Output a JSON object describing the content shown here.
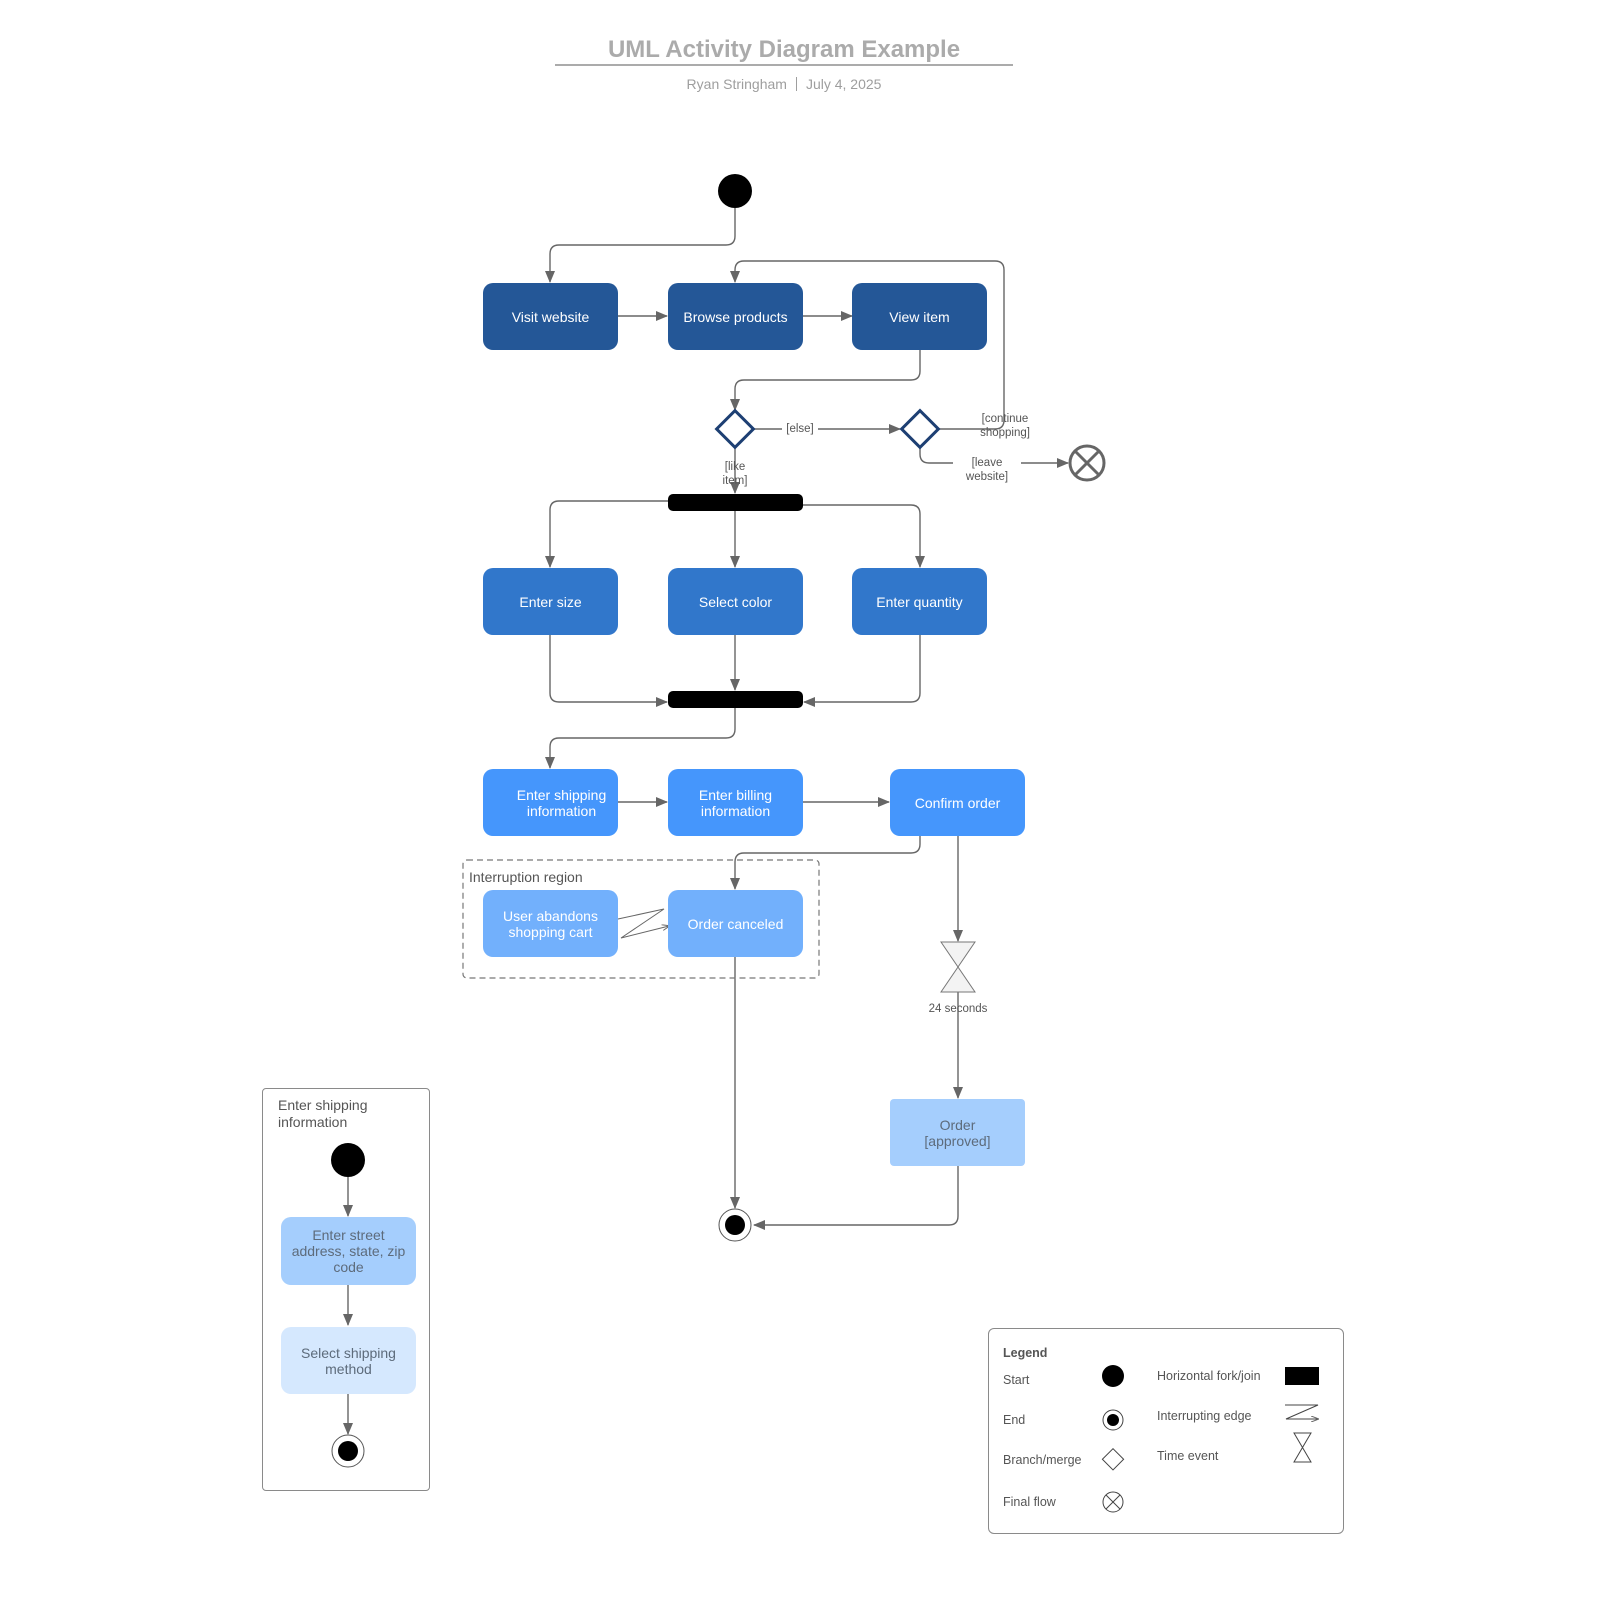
{
  "header": {
    "title": "UML Activity Diagram Example",
    "author": "Ryan Stringham",
    "date": "July 4, 2025"
  },
  "colors": {
    "dark": "#245797",
    "mid": "#3177cb",
    "bright": "#4596fc",
    "light": "#72b0fc",
    "pale": "#a5cefd",
    "paler": "#d5e8fe",
    "decision_stroke": "#1d3f73",
    "edge": "#666666"
  },
  "nodes": {
    "visit_website": "Visit website",
    "browse_products": "Browse products",
    "view_item": "View item",
    "enter_size": "Enter size",
    "select_color": "Select color",
    "enter_quantity": "Enter quantity",
    "enter_shipping": "Enter shipping information",
    "enter_billing": "Enter billing information",
    "confirm_order": "Confirm order",
    "user_abandons": "User abandons shopping cart",
    "order_canceled": "Order canceled",
    "order_approved": "Order [approved]"
  },
  "guards": {
    "else": "[else]",
    "like_item": "[like item]",
    "continue_shopping": "[continue shopping]",
    "leave_website": "[leave website]"
  },
  "interruption_region": {
    "label": "Interruption region"
  },
  "time_event": {
    "label": "24 seconds"
  },
  "subactivity": {
    "title": "Enter shipping information",
    "steps": [
      "Enter street address, state, zip code",
      "Select shipping method"
    ]
  },
  "legend": {
    "title": "Legend",
    "items": [
      {
        "label": "Start",
        "icon": "start-icon"
      },
      {
        "label": "End",
        "icon": "end-icon"
      },
      {
        "label": "Branch/merge",
        "icon": "diamond-icon"
      },
      {
        "label": "Final flow",
        "icon": "final-flow-icon"
      },
      {
        "label": "Horizontal fork/join",
        "icon": "fork-bar-icon"
      },
      {
        "label": "Interrupting edge",
        "icon": "interrupting-edge-icon"
      },
      {
        "label": "Time event",
        "icon": "hourglass-icon"
      }
    ]
  }
}
